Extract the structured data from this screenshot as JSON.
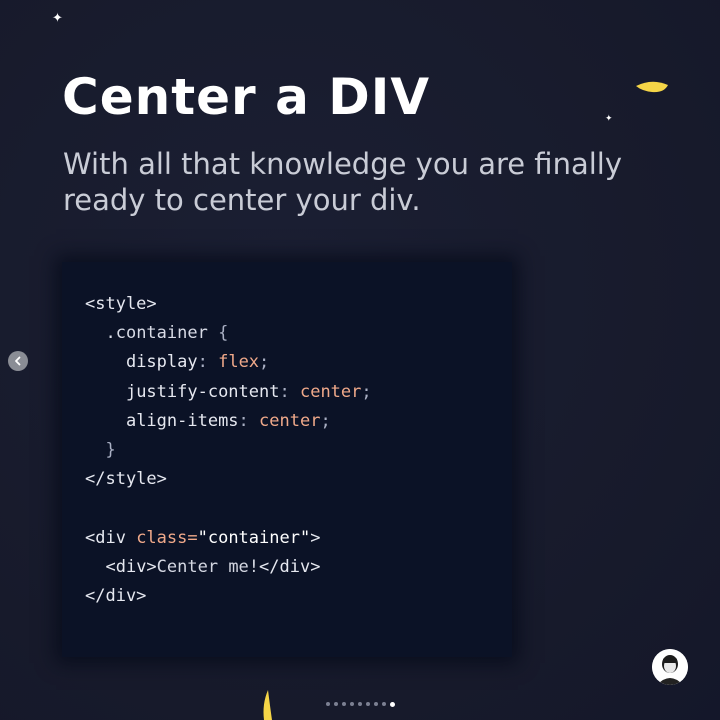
{
  "slide": {
    "title": "Center a DIV",
    "subtitle": "With all that knowledge you are finally ready to center your div."
  },
  "code": {
    "l1_tag": "<style>",
    "l2_selector": ".container",
    "l2_brace": " {",
    "l3_prop": "display",
    "l3_colon": ": ",
    "l3_val": "flex",
    "l3_end": ";",
    "l4_prop": "justify-content",
    "l4_colon": ": ",
    "l4_val": "center",
    "l4_end": ";",
    "l5_prop": "align-items",
    "l5_colon": ": ",
    "l5_val": "center",
    "l5_end": ";",
    "l6_brace": "}",
    "l7_tag": "</style>",
    "l9_open": "<div ",
    "l9_attr": "class=",
    "l9_str": "\"container\"",
    "l9_close": ">",
    "l10_open": "<div>",
    "l10_text": "Center me!",
    "l10_close": "</div>",
    "l11_tag": "</div>"
  },
  "carousel": {
    "total_pages": 9,
    "current_page": 9
  },
  "icons": {
    "prev": "chevron-left-icon",
    "avatar": "profile-avatar",
    "sparkle": "sparkle-icon",
    "moon": "crescent-moon-icon"
  },
  "colors": {
    "background": "#181c2e",
    "code_background": "#0b1226",
    "accent_yellow": "#f5d547",
    "value_orange": "#f0a98a"
  }
}
